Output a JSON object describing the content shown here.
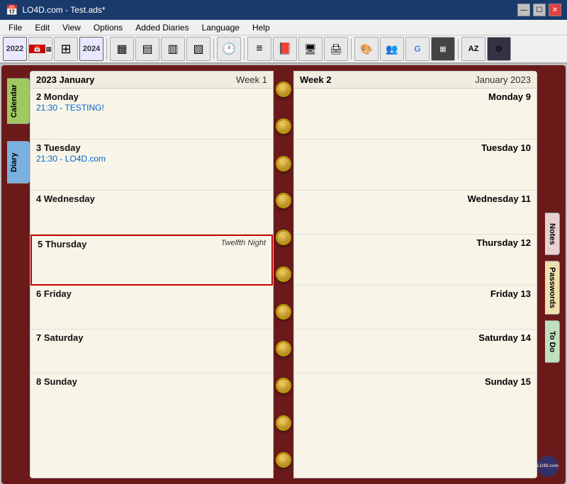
{
  "window": {
    "title": "LO4D.com - Test.ads*",
    "controls": [
      "—",
      "☐",
      "✕"
    ]
  },
  "menu": {
    "items": [
      "File",
      "Edit",
      "View",
      "Options",
      "Added Diaries",
      "Language",
      "Help"
    ]
  },
  "toolbar": {
    "buttons": [
      {
        "name": "year-2022",
        "label": "2022",
        "type": "year"
      },
      {
        "name": "calendar-icon",
        "label": "📅",
        "type": "icon"
      },
      {
        "name": "nav-icon",
        "label": "🗓",
        "type": "icon"
      },
      {
        "name": "year-2024",
        "label": "2024",
        "type": "year"
      },
      {
        "name": "week-view",
        "label": "▦",
        "type": "icon"
      },
      {
        "name": "month-view",
        "label": "▦",
        "type": "icon"
      },
      {
        "name": "year-view",
        "label": "▦",
        "type": "icon"
      },
      {
        "name": "clock-icon",
        "label": "🕐",
        "type": "icon"
      },
      {
        "name": "list-icon",
        "label": "≡",
        "type": "icon"
      },
      {
        "name": "book-icon",
        "label": "📖",
        "type": "icon"
      },
      {
        "name": "notes-icon",
        "label": "📝",
        "type": "icon"
      },
      {
        "name": "print-icon",
        "label": "🖨",
        "type": "icon"
      },
      {
        "name": "color-icon",
        "label": "🎨",
        "type": "icon"
      },
      {
        "name": "people-icon",
        "label": "👥",
        "type": "icon"
      },
      {
        "name": "search-icon",
        "label": "G",
        "type": "icon"
      },
      {
        "name": "image-icon",
        "label": "🖼",
        "type": "icon"
      },
      {
        "name": "az-icon",
        "label": "AZ",
        "type": "icon"
      },
      {
        "name": "settings-icon",
        "label": "⚙",
        "type": "icon"
      }
    ]
  },
  "left_page": {
    "header": {
      "month": "2023 January",
      "week": "Week 1"
    },
    "days": [
      {
        "number": "2",
        "name": "Monday",
        "events": [
          "21:30  -  TESTING!"
        ],
        "holiday": ""
      },
      {
        "number": "3",
        "name": "Tuesday",
        "events": [
          "21:30  -  LO4D.com"
        ],
        "holiday": ""
      },
      {
        "number": "4",
        "name": "Wednesday",
        "events": [],
        "holiday": ""
      },
      {
        "number": "5",
        "name": "Thursday",
        "events": [],
        "holiday": "Twelfth Night"
      },
      {
        "number": "6",
        "name": "Friday",
        "events": [],
        "holiday": ""
      },
      {
        "number": "7",
        "name": "Saturday",
        "events": [],
        "holiday": ""
      },
      {
        "number": "8",
        "name": "Sunday",
        "events": [],
        "holiday": ""
      }
    ]
  },
  "right_page": {
    "header": {
      "week": "Week 2",
      "month": "January 2023"
    },
    "days": [
      {
        "number": "9",
        "name": "Monday",
        "label": "Monday 9"
      },
      {
        "number": "10",
        "name": "Tuesday",
        "label": "Tuesday 10"
      },
      {
        "number": "11",
        "name": "Wednesday",
        "label": "Wednesday 11"
      },
      {
        "number": "12",
        "name": "Thursday",
        "label": "Thursday 12"
      },
      {
        "number": "13",
        "name": "Friday",
        "label": "Friday 13"
      },
      {
        "number": "14",
        "name": "Saturday",
        "label": "Saturday 14"
      },
      {
        "number": "15",
        "name": "Sunday",
        "label": "Sunday 15"
      }
    ]
  },
  "side_tabs": {
    "left": [
      "Calendar",
      "Diary"
    ],
    "right": [
      "Notes",
      "Passwords",
      "To Do"
    ]
  },
  "rings_count": 11,
  "watermark": "LO4D.com"
}
